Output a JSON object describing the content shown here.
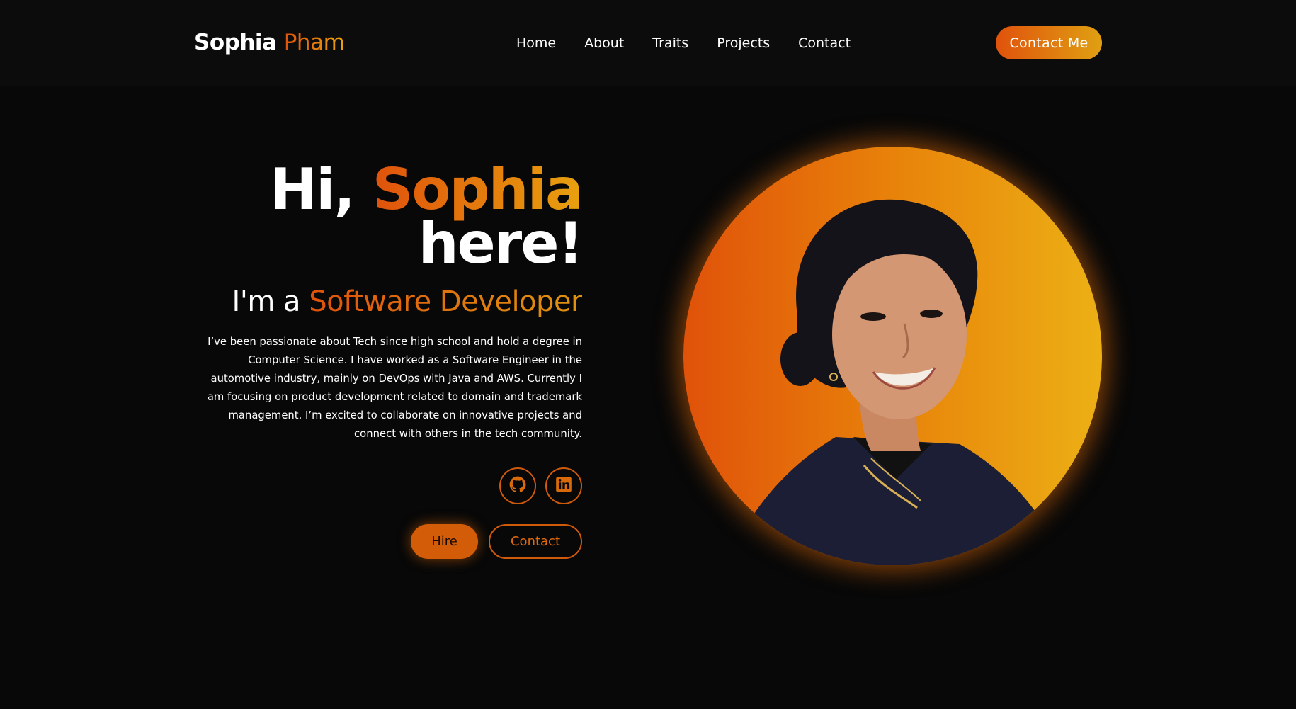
{
  "header": {
    "logo_first": "Sophia",
    "logo_last": "Pham",
    "nav": [
      "Home",
      "About",
      "Traits",
      "Projects",
      "Contact"
    ],
    "cta_label": "Contact Me"
  },
  "hero": {
    "greeting_prefix": "Hi,",
    "greeting_name": "Sophia",
    "greeting_suffix": "here!",
    "role_prefix": "I'm a",
    "role_title": "Software Developer",
    "bio": "I’ve been passionate about Tech since high school and hold a degree in Computer Science. I have worked as a Software Engineer in the automotive industry, mainly on DevOps with Java and AWS. Currently I am focusing on product development related to domain and trademark management. I’m excited to collaborate on innovative projects and connect with others in the tech community.",
    "socials": [
      {
        "icon": "github-icon"
      },
      {
        "icon": "linkedin-icon"
      }
    ],
    "hire_label": "Hire",
    "contact_label": "Contact"
  },
  "colors": {
    "background": "#080808",
    "accent_start": "#e0520c",
    "accent_end": "#e8a10e",
    "hire_button": "#d35c08"
  }
}
